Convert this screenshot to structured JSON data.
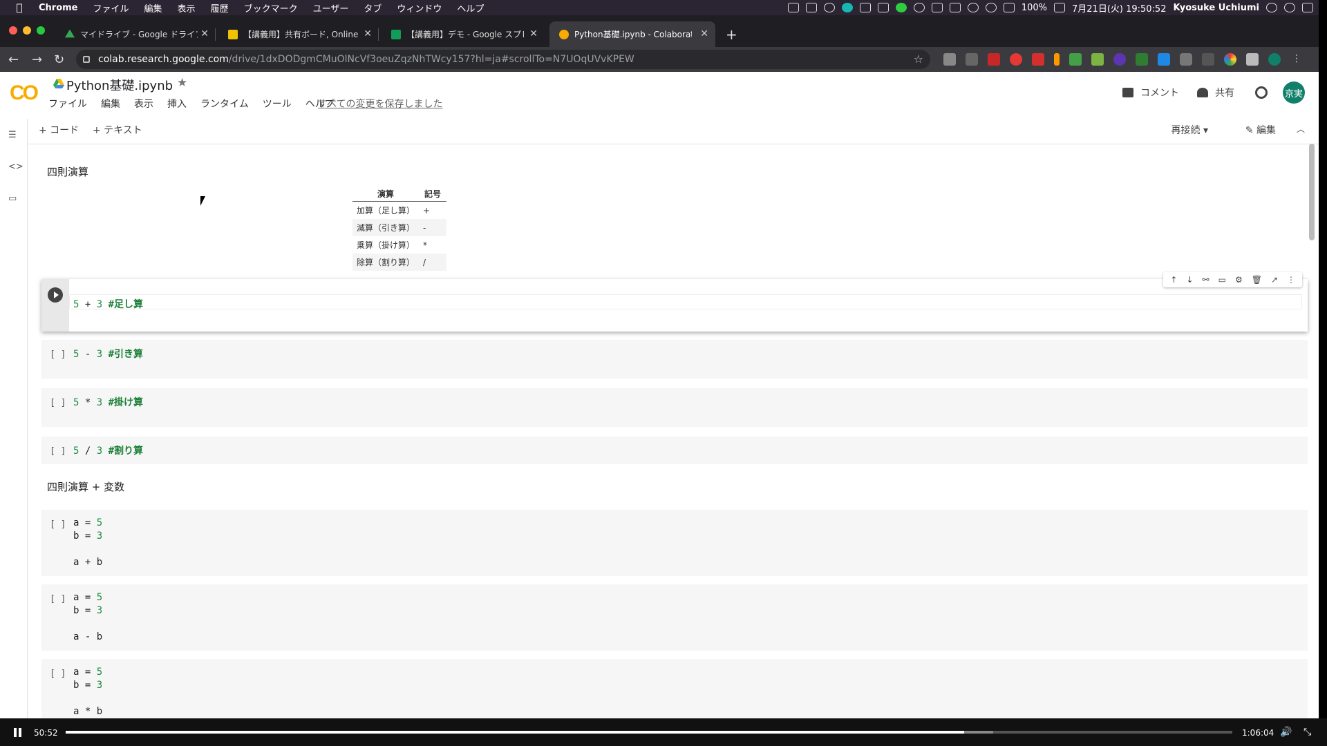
{
  "menubar": {
    "items": [
      "Chrome",
      "ファイル",
      "編集",
      "表示",
      "履歴",
      "ブックマーク",
      "ユーザー",
      "タブ",
      "ウィンドウ",
      "ヘルプ"
    ],
    "battery": "100%",
    "datetime": "7月21日(火) 19:50:52",
    "user": "Kyosuke Uchiumi"
  },
  "tabs": [
    {
      "title": "マイドライブ - Google ドライブ",
      "favicon_color": "#34a853"
    },
    {
      "title": "【講義用】共有ボード, Online Wi",
      "favicon_color": "#f2c200"
    },
    {
      "title": "【講義用】デモ - Google スプレ",
      "favicon_color": "#0f9d58"
    },
    {
      "title": "Python基礎.ipynb - Colaborato",
      "favicon_color": "#f9ab00",
      "active": true
    }
  ],
  "address": {
    "host": "colab.research.google.com",
    "path": "/drive/1dxDODgmCMuOlNcVf3oeuZqzNhTWcy157?hl=ja#scrollTo=N7UOqUVvKPEW"
  },
  "colab": {
    "logo": "CO",
    "title": "Python基礎.ipynb",
    "menu": [
      "ファイル",
      "編集",
      "表示",
      "挿入",
      "ランタイム",
      "ツール",
      "ヘルプ"
    ],
    "saved_status": "すべての変更を保存しました",
    "comment": "コメント",
    "share": "共有",
    "avatar": "京実",
    "add_code": "+ コード",
    "add_text": "+ テキスト",
    "reconnect": "再接続",
    "edit": "編集"
  },
  "notebook": {
    "heading1": "四則演算",
    "table": {
      "headers": [
        "演算",
        "記号"
      ],
      "rows": [
        [
          "加算（足し算）",
          "+"
        ],
        [
          "減算（引き算）",
          "-"
        ],
        [
          "乗算（掛け算）",
          "*"
        ],
        [
          "除算（割り算）",
          "/"
        ]
      ]
    },
    "cells1": [
      {
        "n1": "5",
        "op": "+",
        "n2": "3",
        "comment": "#足し算"
      },
      {
        "n1": "5",
        "op": "-",
        "n2": "3",
        "comment": "#引き算"
      },
      {
        "n1": "5",
        "op": "*",
        "n2": "3",
        "comment": "#掛け算"
      },
      {
        "n1": "5",
        "op": "/",
        "n2": "3",
        "comment": "#割り算"
      }
    ],
    "heading2": "四則演算 + 変数",
    "cells2": [
      {
        "line1a": "a = ",
        "line1b": "5",
        "line2a": "b = ",
        "line2b": "3",
        "line3": "a + b"
      },
      {
        "line1a": "a = ",
        "line1b": "5",
        "line2a": "b = ",
        "line2b": "3",
        "line3": "a - b"
      },
      {
        "line1a": "a = ",
        "line1b": "5",
        "line2a": "b = ",
        "line2b": "3",
        "line3": "a * b"
      }
    ],
    "bracket": "[ ]"
  },
  "video": {
    "current": "50:52",
    "duration": "1:06:04",
    "progress": 0.77,
    "buffered": 0.795
  }
}
